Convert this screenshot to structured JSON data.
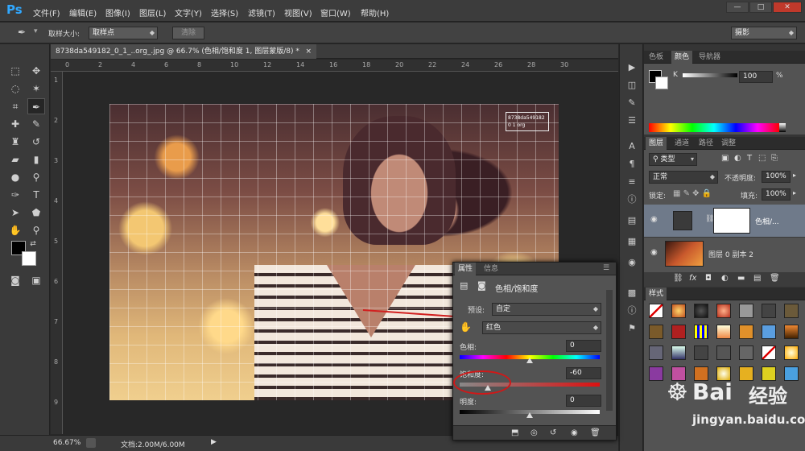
{
  "app": {
    "logo": "Ps"
  },
  "menu": [
    "文件(F)",
    "编辑(E)",
    "图像(I)",
    "图层(L)",
    "文字(Y)",
    "选择(S)",
    "滤镜(T)",
    "视图(V)",
    "窗口(W)",
    "帮助(H)"
  ],
  "window_controls": {
    "minimize": "—",
    "restore": "□",
    "close": "✕"
  },
  "options": {
    "sample_size_label": "取样大小:",
    "sample_size_value": "取样点",
    "clear_button": "清除",
    "workspace": "摄影"
  },
  "document": {
    "tab_title": "8738da549182_0_1_..org_.jpg @ 66.7% (色相/饱和度 1, 图层蒙版/8) *",
    "close": "×"
  },
  "rulers": {
    "top": [
      "0",
      "2",
      "4",
      "6",
      "8",
      "10",
      "12",
      "14",
      "16",
      "18",
      "20",
      "22",
      "24",
      "26",
      "28",
      "30"
    ],
    "left": [
      "1",
      "2",
      "3",
      "4",
      "5",
      "6",
      "7",
      "8",
      "9"
    ]
  },
  "status": {
    "zoom": "66.67%",
    "doc_size": "文档:2.00M/6.00M"
  },
  "photo_stamp": "8738da549182 0 1 org",
  "properties": {
    "tabs": [
      "属性",
      "信息"
    ],
    "adjustment_title": "色相/饱和度",
    "preset_label": "预设:",
    "preset_value": "自定",
    "channel_value": "红色",
    "hue_label": "色相:",
    "hue_value": "0",
    "saturation_label": "饱和度:",
    "saturation_value": "-60",
    "lightness_label": "明度:",
    "lightness_value": "0",
    "slider_positions": {
      "hue": 0.5,
      "saturation": 0.2,
      "lightness": 0.5
    }
  },
  "color_panel": {
    "tabs": [
      "色板",
      "颜色",
      "导航器"
    ],
    "channel": "K",
    "value": "100",
    "unit": "%"
  },
  "layers_panel": {
    "tabs": [
      "图层",
      "通道",
      "路径",
      "调整"
    ],
    "filter_kind": "类型",
    "blend_mode": "正常",
    "opacity_label": "不透明度:",
    "opacity_value": "100%",
    "lock_label": "锁定:",
    "fill_label": "填充:",
    "fill_value": "100%",
    "layers": [
      {
        "name": "色相/...",
        "selected": true
      },
      {
        "name": "图层 0 副本 2",
        "selected": false
      }
    ],
    "footer_icons": [
      "link-icon",
      "fx-icon",
      "mask-icon",
      "adjustment-icon",
      "folder-icon",
      "new-layer-icon",
      "trash-icon"
    ]
  },
  "styles_panel": {
    "tab": "样式"
  },
  "watermark": {
    "brand": "Bai",
    "brand2": "经验",
    "url": "jingyan.baidu.com"
  }
}
